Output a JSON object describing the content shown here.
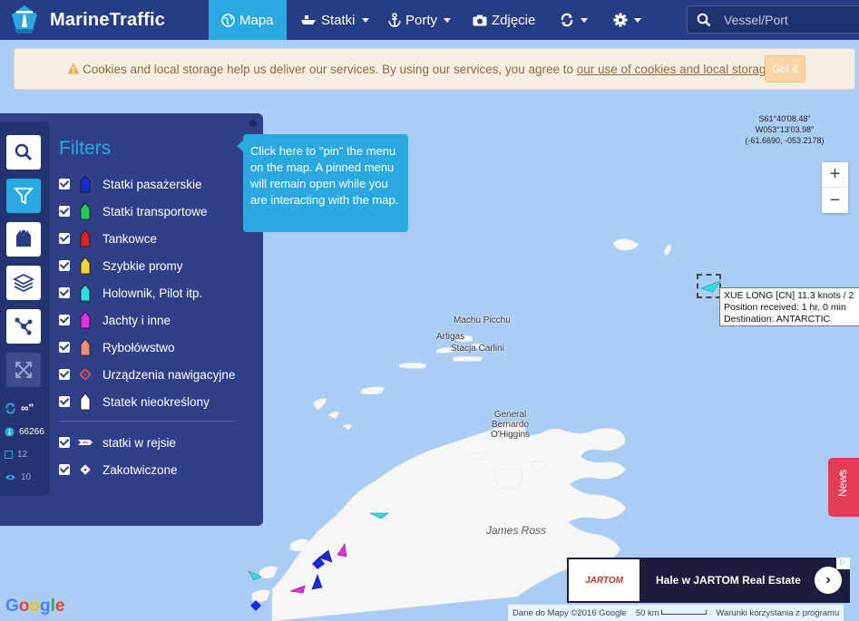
{
  "brand": {
    "name": "MarineTraffic"
  },
  "nav": {
    "map": "Mapa",
    "vessels": "Statki",
    "ports": "Porty",
    "photos": "Zdjęcie"
  },
  "search": {
    "placeholder": "Vessel/Port"
  },
  "cookie": {
    "text": "Cookies and local storage help us deliver our services. By using our services, you agree to ",
    "link": "our use of cookies and local storage",
    "end": ".",
    "button": "Got it"
  },
  "panel": {
    "title": "Filters",
    "filters": [
      {
        "label": "Statki pasażerskie",
        "color": "#1a2bd8"
      },
      {
        "label": "Statki transportowe",
        "color": "#26c957"
      },
      {
        "label": "Tankowce",
        "color": "#d8262b"
      },
      {
        "label": "Szybkie promy",
        "color": "#f6d42e"
      },
      {
        "label": "Holownik, Pilot itp.",
        "color": "#2ee0e6"
      },
      {
        "label": "Jachty i inne",
        "color": "#e02ee0"
      },
      {
        "label": "Rybołówstwo",
        "color": "#f08a7a"
      },
      {
        "label": "Urządzenia nawigacyjne",
        "color": "#e0505a"
      },
      {
        "label": "Statek nieokreślony",
        "color": "#ffffff"
      }
    ],
    "status_filters": [
      {
        "label": "statki w rejsie"
      },
      {
        "label": "Zakotwiczone"
      }
    ]
  },
  "rail": {
    "refresh": "∞\"",
    "vessels_count": "66266",
    "selected_count": "12",
    "views_count": "10"
  },
  "pin_tooltip": "Click here to \"pin\" the menu on the map. A pinned menu will remain open while you are interacting with the map.",
  "coords": {
    "lat": "S61°40'08.48\"",
    "lon": "W053°13'03.98\"",
    "decimal": "(-61.6690, -053.2178)"
  },
  "zoom": {
    "in": "+",
    "out": "−"
  },
  "vessel": {
    "line1": "XUE LONG [CN] 11.3 knots / 2",
    "line2": "Position received: 1 hr, 0 min",
    "line3": "Destination: ANTARCTIC"
  },
  "places": {
    "machu": "Machu Picchu",
    "artigas": "Artigas",
    "carlini": "Stacja Carlini",
    "ohiggins_1": "General",
    "ohiggins_2": "Bernardo",
    "ohiggins_3": "O'Higgins",
    "james": "James Ross"
  },
  "news": "News",
  "ad": {
    "logo": "JARTOM",
    "title": "Hale w JARTOM Real Estate",
    "choice": "▷"
  },
  "footer": {
    "google": "Google",
    "map_data": "Dane do Mapy ©2016 Google",
    "scale": "50 km",
    "terms": "Warunki korzystania z programu"
  }
}
